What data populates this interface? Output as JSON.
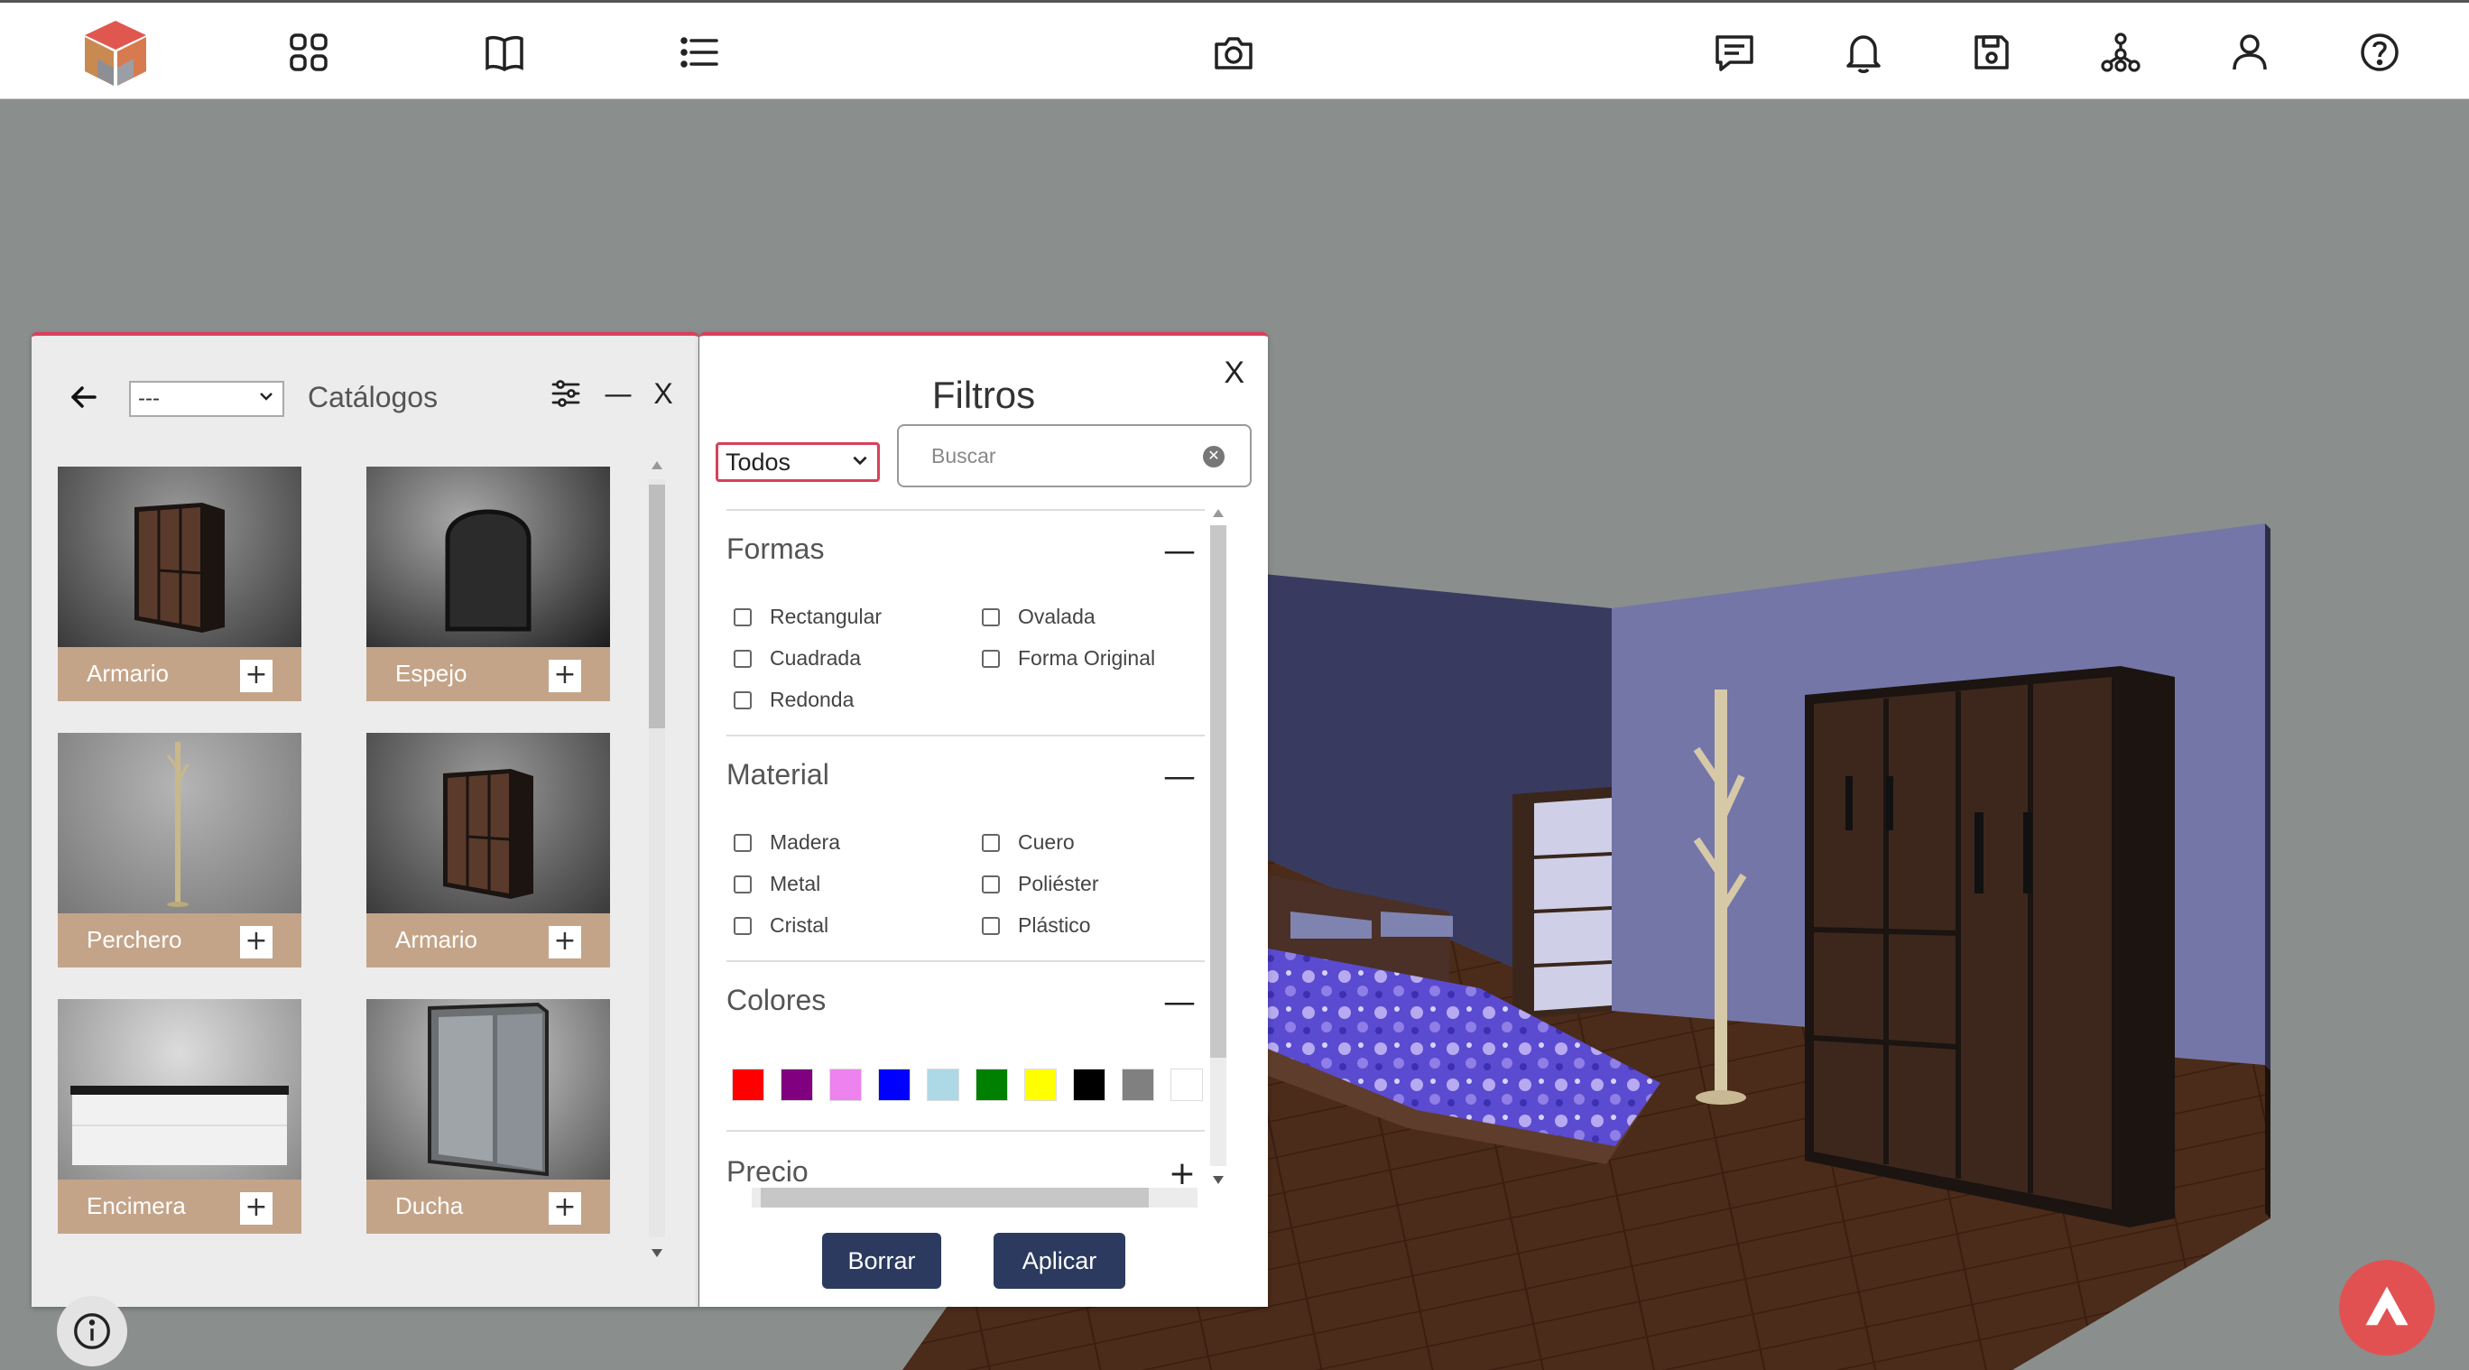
{
  "topbar": {
    "icons": [
      "logo-icon",
      "grid-icon",
      "book-icon",
      "list-icon",
      "camera-icon",
      "chat-icon",
      "bell-icon",
      "save-icon",
      "network-icon",
      "user-icon",
      "help-icon"
    ]
  },
  "catalog": {
    "select_value": "---",
    "title": "Catálogos",
    "close_label": "X",
    "minimize_label": "—",
    "items": [
      {
        "label": "Armario",
        "plus": "+"
      },
      {
        "label": "Espejo",
        "plus": "+"
      },
      {
        "label": "Perchero",
        "plus": "+"
      },
      {
        "label": "Armario",
        "plus": "+"
      },
      {
        "label": "Encimera",
        "plus": "+"
      },
      {
        "label": "Ducha",
        "plus": "+"
      }
    ]
  },
  "filters": {
    "close_label": "X",
    "title": "Filtros",
    "select_value": "Todos",
    "search_placeholder": "Buscar",
    "sections": {
      "formas": {
        "title": "Formas",
        "toggle": "—",
        "options": [
          "Rectangular",
          "Ovalada",
          "Cuadrada",
          "Forma Original",
          "Redonda"
        ]
      },
      "material": {
        "title": "Material",
        "toggle": "—",
        "options": [
          "Madera",
          "Cuero",
          "Metal",
          "Poliéster",
          "Cristal",
          "Plástico"
        ]
      },
      "colores": {
        "title": "Colores",
        "toggle": "—",
        "swatches": [
          "#ff0000",
          "#800080",
          "#ee82ee",
          "#0000ff",
          "#add8e6",
          "#008000",
          "#ffff00",
          "#000000",
          "#808080",
          "#ffffff"
        ]
      },
      "precio": {
        "title": "Precio",
        "toggle": "+"
      }
    },
    "buttons": {
      "clear": "Borrar",
      "apply": "Aplicar"
    }
  }
}
